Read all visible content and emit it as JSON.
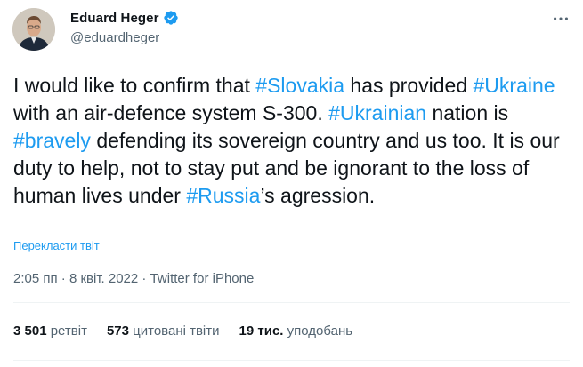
{
  "author": {
    "display_name": "Eduard Heger",
    "handle": "@eduardheger",
    "verified": true
  },
  "tweet": {
    "segments": [
      {
        "text": "I would like to confirm that ",
        "type": "text"
      },
      {
        "text": "#Slovakia",
        "type": "hashtag"
      },
      {
        "text": " has provided ",
        "type": "text"
      },
      {
        "text": "#Ukraine",
        "type": "hashtag"
      },
      {
        "text": " with an air-defence system S-300. ",
        "type": "text"
      },
      {
        "text": "#Ukrainian",
        "type": "hashtag"
      },
      {
        "text": " nation is ",
        "type": "text"
      },
      {
        "text": "#bravely",
        "type": "hashtag"
      },
      {
        "text": " defending its sovereign country and us too. It is our duty to help, not to stay put and be ignorant to the loss of human lives under ",
        "type": "text"
      },
      {
        "text": "#Russia",
        "type": "hashtag"
      },
      {
        "text": "’s agression.",
        "type": "text"
      }
    ],
    "translate_label": "Перекласти твіт"
  },
  "meta": {
    "time": "2:05 пп",
    "separator": "·",
    "date": "8 квіт. 2022",
    "source": "Twitter for iPhone"
  },
  "stats": [
    {
      "count": "3 501",
      "label": "ретвіт"
    },
    {
      "count": "573",
      "label": "цитовані твіти"
    },
    {
      "count": "19 тис.",
      "label": "уподобань"
    }
  ],
  "colors": {
    "link": "#1d9bf0",
    "secondary_text": "#536471",
    "primary_text": "#0f1419",
    "verified_badge": "#1d9bf0"
  },
  "icons": {
    "verified": "verified-badge-icon",
    "more": "more-options-icon"
  }
}
